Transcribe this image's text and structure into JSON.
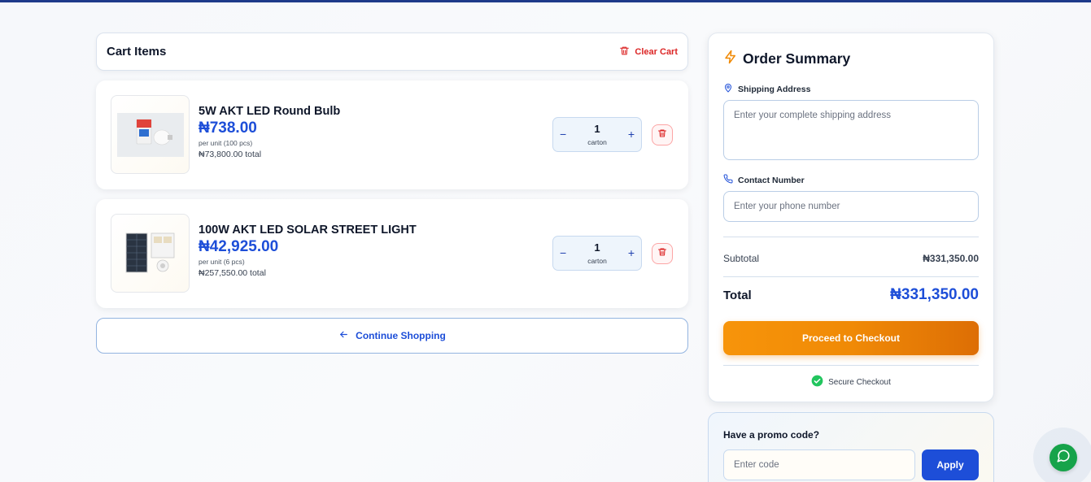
{
  "cart": {
    "title": "Cart Items",
    "clear_label": "Clear Cart",
    "continue_label": "Continue Shopping",
    "items": [
      {
        "name": "5W AKT LED Round Bulb",
        "price": "₦738.00",
        "unit_note": "per unit (100 pcs)",
        "total": "₦73,800.00 total",
        "quantity": "1",
        "quantity_unit": "carton"
      },
      {
        "name": "100W AKT LED SOLAR STREET LIGHT",
        "price": "₦42,925.00",
        "unit_note": "per unit (6 pcs)",
        "total": "₦257,550.00 total",
        "quantity": "1",
        "quantity_unit": "carton"
      }
    ]
  },
  "summary": {
    "title": "Order Summary",
    "shipping_label": "Shipping Address",
    "shipping_placeholder": "Enter your complete shipping address",
    "shipping_value": "",
    "contact_label": "Contact Number",
    "contact_placeholder": "Enter your phone number",
    "contact_value": "",
    "subtotal_label": "Subtotal",
    "subtotal_value": "₦331,350.00",
    "total_label": "Total",
    "total_value": "₦331,350.00",
    "checkout_label": "Proceed to Checkout",
    "secure_label": "Secure Checkout"
  },
  "promo": {
    "title": "Have a promo code?",
    "placeholder": "Enter code",
    "value": "",
    "apply_label": "Apply"
  },
  "colors": {
    "accent_blue": "#1d4ed8",
    "checkout_orange": "#f08a06",
    "danger_red": "#dc2626",
    "chat_green": "#16a34a"
  },
  "icons": {
    "clear_cart": "trash-icon",
    "delete_item": "trash-icon",
    "continue": "arrow-left-icon",
    "summary": "lightning-icon",
    "shipping": "map-pin-icon",
    "contact": "phone-icon",
    "secure": "check-circle-icon",
    "chat": "chat-bubble-icon"
  }
}
